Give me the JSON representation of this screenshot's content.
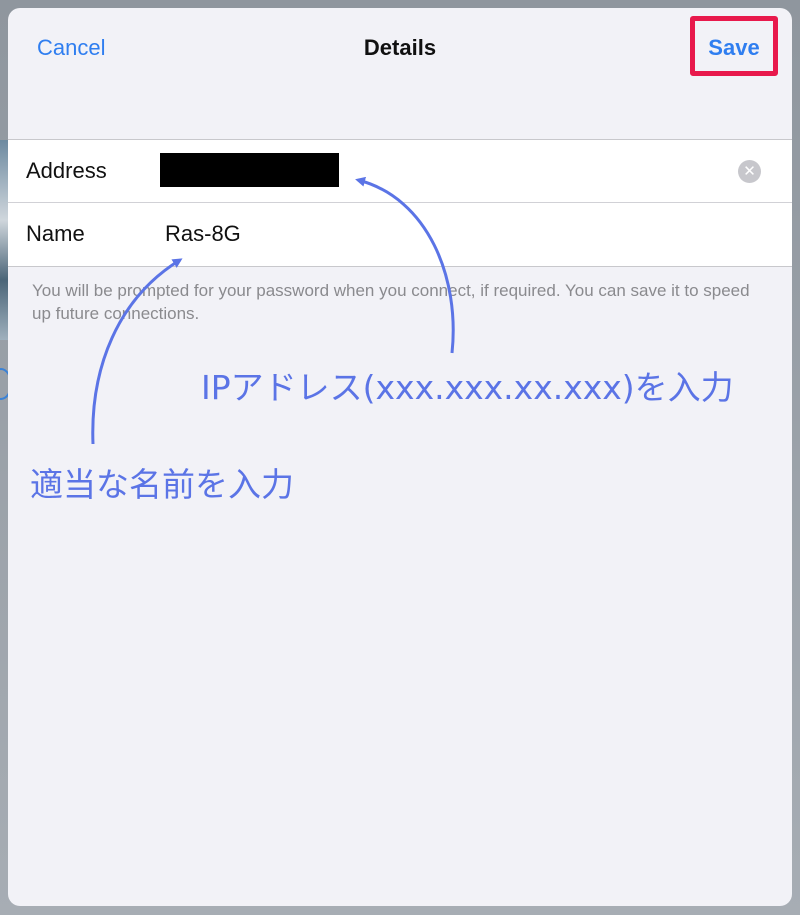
{
  "navbar": {
    "cancel_label": "Cancel",
    "title": "Details",
    "save_label": "Save"
  },
  "form": {
    "address": {
      "label": "Address",
      "clear_icon": "clear-circle-icon"
    },
    "name": {
      "label": "Name",
      "value": "Ras-8G"
    }
  },
  "footer_note": "You will be prompted for your password when you connect, if required. You can save it to speed up future connections.",
  "annotations": {
    "ip_hint": "IPアドレス(xxx.xxx.xx.xxx)を入力",
    "name_hint": "適当な名前を入力"
  },
  "colors": {
    "accent": "#2f7ef0",
    "highlight_box": "#e8194c",
    "annotation": "#5b74e6",
    "sheet_background": "#f2f2f7"
  }
}
